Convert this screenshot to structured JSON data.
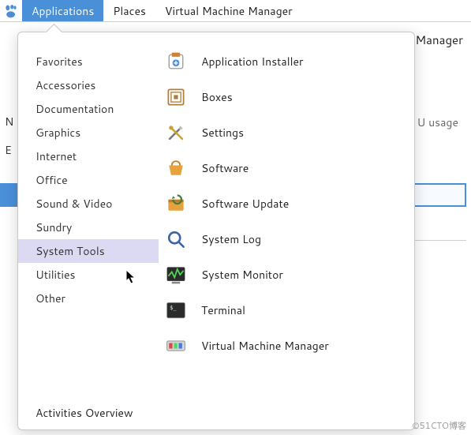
{
  "panel": {
    "items": [
      {
        "label": "Applications",
        "active": true
      },
      {
        "label": "Places",
        "active": false
      },
      {
        "label": "Virtual Machine Manager",
        "active": false
      }
    ]
  },
  "background": {
    "window_title_fragment": "Manager",
    "cpu_label": "U usage",
    "edge_n": "N",
    "edge_e": "E"
  },
  "menu": {
    "categories": [
      "Favorites",
      "Accessories",
      "Documentation",
      "Graphics",
      "Internet",
      "Office",
      "Sound & Video",
      "Sundry",
      "System Tools",
      "Utilities",
      "Other"
    ],
    "selected_category_index": 8,
    "activities_label": "Activities Overview",
    "apps": [
      {
        "icon": "application-installer",
        "label": "Application Installer"
      },
      {
        "icon": "boxes",
        "label": "Boxes"
      },
      {
        "icon": "settings",
        "label": "Settings"
      },
      {
        "icon": "software",
        "label": "Software"
      },
      {
        "icon": "software-update",
        "label": "Software Update"
      },
      {
        "icon": "system-log",
        "label": "System Log"
      },
      {
        "icon": "system-monitor",
        "label": "System Monitor"
      },
      {
        "icon": "terminal",
        "label": "Terminal"
      },
      {
        "icon": "virtual-machine-manager",
        "label": "Virtual Machine Manager"
      }
    ]
  },
  "watermark": "©51CTO博客"
}
